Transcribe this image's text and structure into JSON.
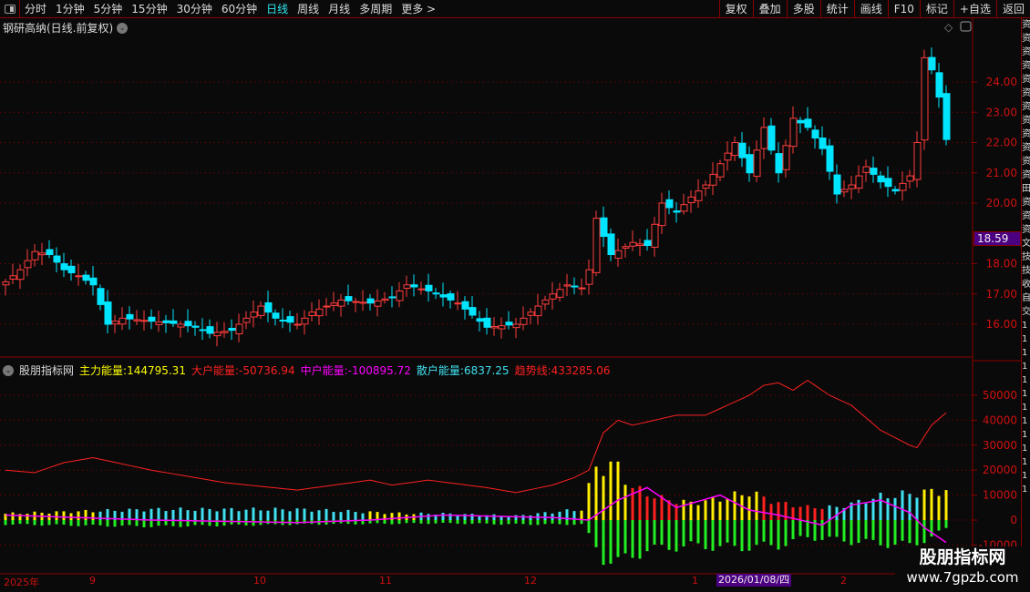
{
  "toolbar": {
    "periods": [
      "分时",
      "1分钟",
      "5分钟",
      "15分钟",
      "30分钟",
      "60分钟",
      "日线",
      "周线",
      "月线",
      "多周期",
      "更多 >"
    ],
    "active_period": "日线",
    "buttons": [
      "复权",
      "叠加",
      "多股",
      "统计",
      "画线",
      "F10",
      "标记",
      "+自选",
      "返回"
    ]
  },
  "main": {
    "title": "钢研高纳(日线.前复权)",
    "current_price": "18.59",
    "yticks": [
      "24.00",
      "23.00",
      "22.00",
      "21.00",
      "20.00",
      "18.00",
      "17.00",
      "16.00"
    ],
    "ytick_values": [
      24,
      23,
      22,
      21,
      20,
      18,
      17,
      16
    ]
  },
  "indicator": {
    "name": "股朋指标网",
    "items": [
      {
        "label": "主力能量:",
        "value": "144795.31",
        "color": "#ffff00"
      },
      {
        "label": "大户能量:",
        "value": "-50736.94",
        "color": "#ff2020"
      },
      {
        "label": "中户能量:",
        "value": "-100895.72",
        "color": "#ff00ff"
      },
      {
        "label": "散户能量:",
        "value": "6837.25",
        "color": "#40e0f0"
      },
      {
        "label": "趋势线:",
        "value": "433285.06",
        "color": "#ff2020"
      }
    ],
    "yticks": [
      "50000",
      "40000",
      "30000",
      "20000",
      "10000",
      "0",
      "-10000"
    ],
    "ytick_values": [
      50000,
      40000,
      30000,
      20000,
      10000,
      0,
      -10000
    ]
  },
  "xaxis": {
    "labels": [
      "2025年",
      "9",
      "10",
      "11",
      "12",
      "1",
      "2"
    ],
    "crosshair_date": "2026/01/08/四"
  },
  "watermark": {
    "line1": "股朋指标网",
    "line2": "www.7gpzb.com"
  },
  "right_strip": "资资资资资资资资资资资资田资资资文技技收自交1111111111111",
  "chart_data": {
    "type": "candlestick",
    "candle_count": 130,
    "close_keypoints": [
      [
        0,
        17.4
      ],
      [
        2,
        17.8
      ],
      [
        4,
        18.4
      ],
      [
        6,
        18.3
      ],
      [
        8,
        17.8
      ],
      [
        10,
        17.6
      ],
      [
        12,
        17.3
      ],
      [
        14,
        16.0
      ],
      [
        16,
        16.2
      ],
      [
        20,
        16.1
      ],
      [
        24,
        16.0
      ],
      [
        26,
        15.9
      ],
      [
        28,
        15.7
      ],
      [
        31,
        15.8
      ],
      [
        33,
        16.2
      ],
      [
        35,
        16.6
      ],
      [
        37,
        16.2
      ],
      [
        40,
        16.0
      ],
      [
        42,
        16.4
      ],
      [
        46,
        16.8
      ],
      [
        50,
        16.7
      ],
      [
        53,
        16.9
      ],
      [
        55,
        17.3
      ],
      [
        58,
        17.1
      ],
      [
        62,
        16.7
      ],
      [
        64,
        16.3
      ],
      [
        66,
        15.9
      ],
      [
        70,
        16.0
      ],
      [
        73,
        16.6
      ],
      [
        75,
        17.0
      ],
      [
        77,
        17.3
      ],
      [
        79,
        17.2
      ],
      [
        80,
        17.8
      ],
      [
        81,
        19.5
      ],
      [
        83,
        18.3
      ],
      [
        86,
        18.7
      ],
      [
        88,
        18.6
      ],
      [
        90,
        20.0
      ],
      [
        92,
        19.7
      ],
      [
        94,
        20.2
      ],
      [
        96,
        20.6
      ],
      [
        98,
        21.3
      ],
      [
        100,
        22.0
      ],
      [
        102,
        21.0
      ],
      [
        104,
        22.5
      ],
      [
        106,
        21.0
      ],
      [
        108,
        22.8
      ],
      [
        110,
        22.5
      ],
      [
        112,
        21.8
      ],
      [
        114,
        20.3
      ],
      [
        116,
        20.6
      ],
      [
        118,
        21.2
      ],
      [
        120,
        20.7
      ],
      [
        122,
        20.4
      ],
      [
        124,
        20.9
      ],
      [
        125,
        22.0
      ],
      [
        126,
        24.8
      ],
      [
        127,
        24.4
      ],
      [
        128,
        23.5
      ],
      [
        129,
        22.1
      ]
    ],
    "trend_keypoints": [
      [
        0,
        20000
      ],
      [
        4,
        19000
      ],
      [
        8,
        23000
      ],
      [
        12,
        25000
      ],
      [
        20,
        20000
      ],
      [
        30,
        15000
      ],
      [
        40,
        12000
      ],
      [
        50,
        16000
      ],
      [
        53,
        14000
      ],
      [
        58,
        16000
      ],
      [
        66,
        13000
      ],
      [
        70,
        11000
      ],
      [
        75,
        14000
      ],
      [
        78,
        17000
      ],
      [
        80,
        20000
      ],
      [
        82,
        35000
      ],
      [
        84,
        40000
      ],
      [
        86,
        38000
      ],
      [
        92,
        42000
      ],
      [
        96,
        42000
      ],
      [
        102,
        50000
      ],
      [
        104,
        54000
      ],
      [
        106,
        55000
      ],
      [
        108,
        52000
      ],
      [
        110,
        56000
      ],
      [
        113,
        50000
      ],
      [
        116,
        46000
      ],
      [
        120,
        36000
      ],
      [
        124,
        30000
      ],
      [
        125,
        29000
      ],
      [
        127,
        38000
      ],
      [
        129,
        43000
      ]
    ],
    "pos_keypoints": [
      [
        0,
        3000
      ],
      [
        10,
        4000
      ],
      [
        20,
        5000
      ],
      [
        40,
        5000
      ],
      [
        55,
        3000
      ],
      [
        60,
        3000
      ],
      [
        70,
        2000
      ],
      [
        79,
        5000
      ],
      [
        81,
        25000
      ],
      [
        84,
        25000
      ],
      [
        86,
        15000
      ],
      [
        90,
        10000
      ],
      [
        94,
        8000
      ],
      [
        98,
        10000
      ],
      [
        102,
        13000
      ],
      [
        106,
        8000
      ],
      [
        110,
        6000
      ],
      [
        114,
        6000
      ],
      [
        120,
        11000
      ],
      [
        126,
        13000
      ],
      [
        129,
        14000
      ]
    ],
    "neg_keypoints": [
      [
        0,
        -2000
      ],
      [
        20,
        -3000
      ],
      [
        40,
        -2000
      ],
      [
        60,
        -1500
      ],
      [
        70,
        -2000
      ],
      [
        79,
        -2000
      ],
      [
        82,
        -18000
      ],
      [
        84,
        -20000
      ],
      [
        88,
        -14000
      ],
      [
        94,
        -12000
      ],
      [
        100,
        -13000
      ],
      [
        106,
        -12000
      ],
      [
        110,
        -8000
      ],
      [
        116,
        -10000
      ],
      [
        124,
        -12000
      ],
      [
        127,
        -8000
      ],
      [
        129,
        -4000
      ]
    ],
    "mid_keypoints": [
      [
        0,
        2000
      ],
      [
        10,
        1000
      ],
      [
        20,
        0
      ],
      [
        40,
        -1000
      ],
      [
        50,
        0
      ],
      [
        60,
        2000
      ],
      [
        75,
        1000
      ],
      [
        80,
        0
      ],
      [
        84,
        8000
      ],
      [
        88,
        13000
      ],
      [
        92,
        5000
      ],
      [
        98,
        10000
      ],
      [
        102,
        4000
      ],
      [
        106,
        2000
      ],
      [
        112,
        -2000
      ],
      [
        116,
        6000
      ],
      [
        120,
        8000
      ],
      [
        124,
        3000
      ],
      [
        126,
        -3000
      ],
      [
        129,
        -9000
      ]
    ],
    "yellow_ranges": [
      [
        0,
        12
      ],
      [
        50,
        56
      ],
      [
        79,
        86
      ],
      [
        92,
        104
      ],
      [
        126,
        129
      ]
    ],
    "red_ranges": [
      [
        86,
        92
      ],
      [
        104,
        112
      ]
    ],
    "colors": {
      "up": "#ff3c3c",
      "down": "#00e5ff",
      "grid": "#8b0000",
      "trend": "#ff2020",
      "mid": "#ff00ff",
      "neg": "#22ee22",
      "pos_cyan": "#40e0f0",
      "pos_yellow": "#ffee00"
    }
  }
}
